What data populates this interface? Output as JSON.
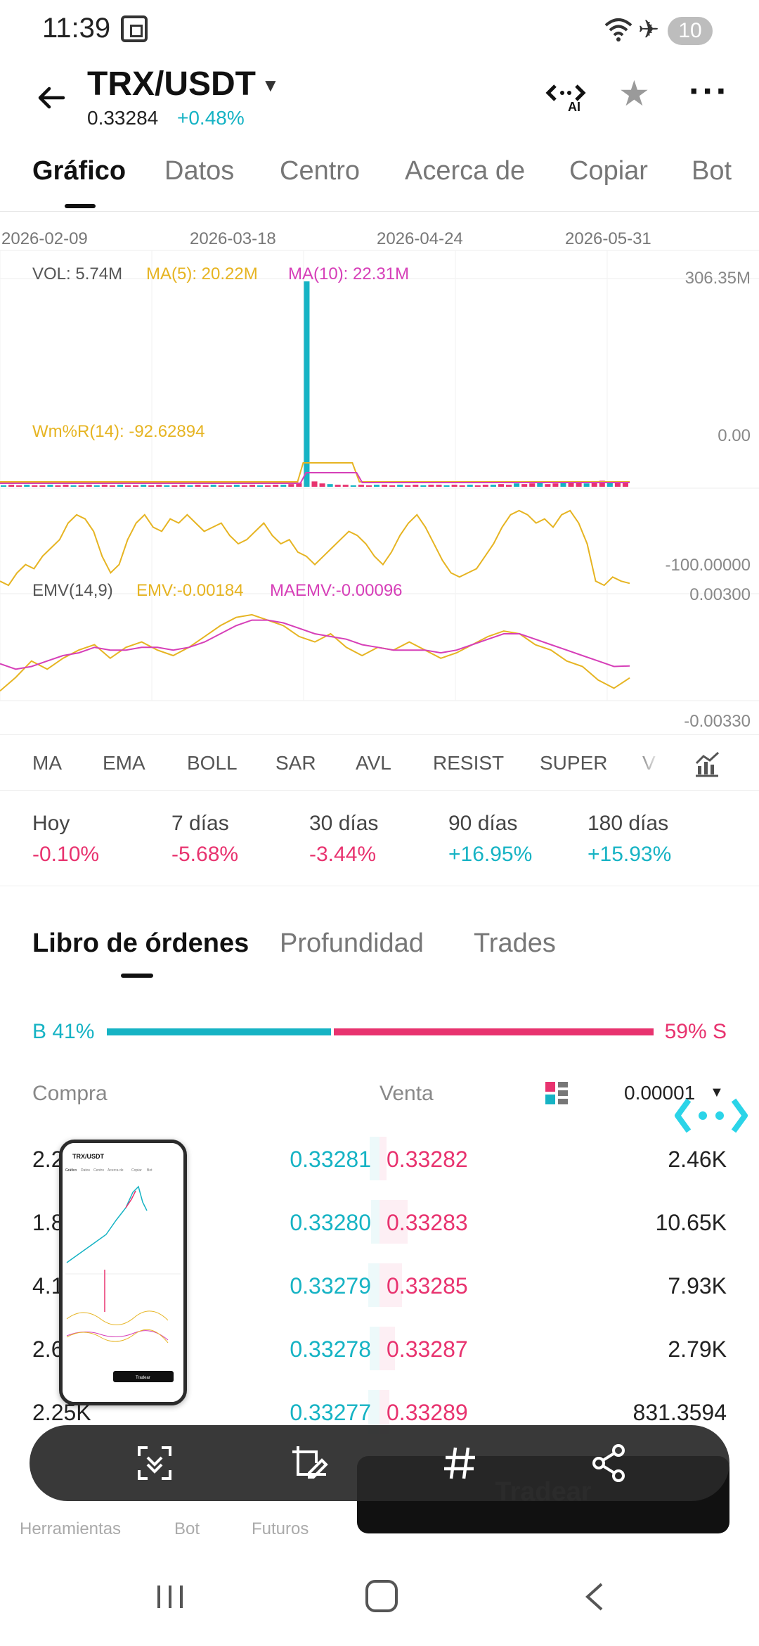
{
  "status_bar": {
    "time": "11:39",
    "battery": "10"
  },
  "header": {
    "pair": "TRX/USDT",
    "price": "0.33284",
    "change": "+0.48%",
    "ai_label": "AI"
  },
  "tabs": [
    "Gráfico",
    "Datos",
    "Centro",
    "Acerca de",
    "Copiar",
    "Bot"
  ],
  "chart": {
    "dates": [
      "2026-02-09",
      "2026-03-18",
      "2026-04-24",
      "2026-05-31"
    ],
    "volume": {
      "vol": "VOL: 5.74M",
      "ma5": "MA(5): 20.22M",
      "ma10": "MA(10): 22.31M",
      "axis_top": "306.35M"
    },
    "wmr": {
      "label": "Wm%R(14): -92.62894",
      "axis_top": "0.00",
      "axis_bottom": "-100.00000"
    },
    "emv": {
      "label": "EMV(14,9)",
      "emv": "EMV:-0.00184",
      "maemv": "MAEMV:-0.00096",
      "axis_top": "0.00300",
      "axis_bottom": "-0.00330"
    }
  },
  "chart_data": [
    {
      "type": "bar",
      "title": "VOL",
      "series": [
        {
          "name": "VOL",
          "values": [
            2,
            3,
            2,
            3,
            2,
            2,
            3,
            2,
            3,
            2,
            2,
            3,
            2,
            3,
            2,
            3,
            2,
            2,
            3,
            2,
            3,
            2,
            2,
            3,
            2,
            3,
            2,
            3,
            2,
            2,
            3,
            2,
            3,
            2,
            2,
            3,
            3,
            4,
            6,
            306.35,
            8,
            5,
            4,
            3,
            3,
            2,
            3,
            2,
            3,
            3,
            2,
            3,
            2,
            3,
            2,
            3,
            3,
            2,
            3,
            2,
            3,
            2,
            3,
            3,
            4,
            3,
            5,
            4,
            5,
            6,
            4,
            5,
            6,
            7,
            6,
            5,
            8,
            9,
            7,
            6,
            8
          ]
        }
      ],
      "ylim": [
        0,
        306.35
      ]
    },
    {
      "type": "line",
      "title": "Wm%R(14)",
      "series": [
        {
          "name": "Wm%R",
          "values": [
            -90,
            -95,
            -80,
            -70,
            -75,
            -60,
            -50,
            -40,
            -20,
            -10,
            -15,
            -30,
            -60,
            -80,
            -70,
            -40,
            -20,
            -10,
            -25,
            -30,
            -15,
            -20,
            -10,
            -20,
            -30,
            -25,
            -20,
            -35,
            -45,
            -40,
            -30,
            -20,
            -35,
            -45,
            -40,
            -55,
            -60,
            -70,
            -60,
            -50,
            -40,
            -30,
            -35,
            -45,
            -60,
            -70,
            -55,
            -35,
            -20,
            -10,
            -25,
            -45,
            -65,
            -80,
            -85,
            -80,
            -75,
            -60,
            -45,
            -25,
            -10,
            -5,
            -10,
            -20,
            -15,
            -25,
            -10,
            -5,
            -20,
            -45,
            -90,
            -95,
            -85,
            -90,
            -92.6
          ]
        }
      ],
      "ylim": [
        -100,
        0
      ]
    },
    {
      "type": "line",
      "title": "EMV(14,9)",
      "series": [
        {
          "name": "EMV",
          "values": [
            -0.0028,
            -0.0018,
            -0.0006,
            -0.0012,
            -0.0004,
            0.0002,
            0.0006,
            -0.0004,
            0.0004,
            0.0008,
            0.0002,
            -0.0002,
            0.0004,
            0.0012,
            0.002,
            0.0026,
            0.0028,
            0.0024,
            0.002,
            0.0012,
            0.0008,
            0.0014,
            0.0004,
            -0.0002,
            0.0004,
            0.0002,
            0.0008,
            0.0002,
            -0.0004,
            0.0,
            0.0006,
            0.0012,
            0.0016,
            0.0014,
            0.0006,
            0.0002,
            -0.0006,
            -0.001,
            -0.002,
            -0.0026,
            -0.00184
          ]
        },
        {
          "name": "MAEMV",
          "values": [
            -0.0008,
            -0.0012,
            -0.001,
            -0.0006,
            -0.0002,
            0.0,
            0.0004,
            0.0002,
            0.0002,
            0.0004,
            0.0004,
            0.0002,
            0.0004,
            0.0008,
            0.0014,
            0.002,
            0.0024,
            0.0024,
            0.0022,
            0.0018,
            0.0014,
            0.0012,
            0.001,
            0.0006,
            0.0004,
            0.0002,
            0.0002,
            0.0002,
            0.0,
            0.0002,
            0.0006,
            0.001,
            0.0014,
            0.0014,
            0.001,
            0.0006,
            0.0002,
            -0.0002,
            -0.0006,
            -0.001,
            -0.00096
          ]
        }
      ],
      "ylim": [
        -0.0033,
        0.003
      ]
    }
  ],
  "colors": {
    "buy": "#16b3c4",
    "sell": "#e8336f",
    "ma5": "#e6b422",
    "ma10": "#d63fb8",
    "emv": "#e6b422",
    "maemv": "#d63fb8"
  },
  "indicator_buttons": [
    "MA",
    "EMA",
    "BOLL",
    "SAR",
    "AVL",
    "RESIST",
    "SUPER",
    "V"
  ],
  "performance": [
    {
      "label": "Hoy",
      "value": "-0.10%",
      "dir": "neg"
    },
    {
      "label": "7 días",
      "value": "-5.68%",
      "dir": "neg"
    },
    {
      "label": "30 días",
      "value": "-3.44%",
      "dir": "neg"
    },
    {
      "label": "90 días",
      "value": "+16.95%",
      "dir": "pos"
    },
    {
      "label": "180 días",
      "value": "+15.93%",
      "dir": "pos"
    }
  ],
  "orderbook": {
    "tabs": [
      "Libro de órdenes",
      "Profundidad",
      "Trades"
    ],
    "buy_ratio": "B 41%",
    "sell_ratio": "59% S",
    "buy_fraction": 0.41,
    "head_buy": "Compra",
    "head_sell": "Venta",
    "precision": "0.00001",
    "rows": [
      {
        "buy_qty": "2.2",
        "buy_price": "0.33281",
        "sell_price": "0.33282",
        "sell_qty": "2.46K"
      },
      {
        "buy_qty": "1.8",
        "buy_price": "0.33280",
        "sell_price": "0.33283",
        "sell_qty": "10.65K"
      },
      {
        "buy_qty": "4.1",
        "buy_price": "0.33279",
        "sell_price": "0.33285",
        "sell_qty": "7.93K"
      },
      {
        "buy_qty": "2.6",
        "buy_price": "0.33278",
        "sell_price": "0.33287",
        "sell_qty": "2.79K"
      },
      {
        "buy_qty": "2.25K",
        "buy_price": "0.33277",
        "sell_price": "0.33289",
        "sell_qty": "831.3594"
      }
    ]
  },
  "bottom_nav": {
    "items": [
      "Herramientas",
      "Bot",
      "Futuros"
    ],
    "trade": "Tradear"
  },
  "pip": {
    "pair": "TRX/USDT",
    "tabs": [
      "Gráfico",
      "Datos",
      "Centro",
      "Acerca de",
      "Copiar",
      "Bot"
    ],
    "trade": "Tradear"
  }
}
